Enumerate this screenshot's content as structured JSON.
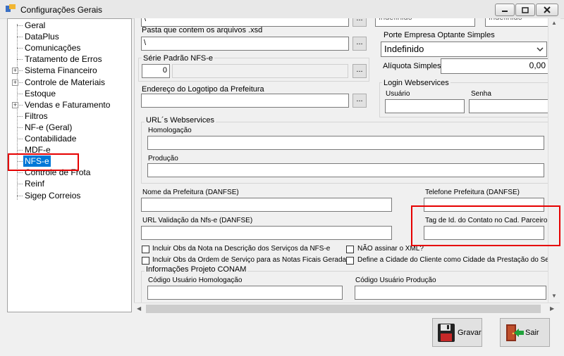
{
  "window": {
    "title": "Configurações Gerais"
  },
  "tree": {
    "items": [
      {
        "label": "Geral"
      },
      {
        "label": "DataPlus"
      },
      {
        "label": "Comunicações"
      },
      {
        "label": "Tratamento de Erros"
      },
      {
        "label": "Sistema Financeiro",
        "expander": "+"
      },
      {
        "label": "Controle de Materiais",
        "expander": "+"
      },
      {
        "label": "Estoque"
      },
      {
        "label": "Vendas e Faturamento",
        "expander": "+"
      },
      {
        "label": "Filtros"
      },
      {
        "label": "NF-e (Geral)"
      },
      {
        "label": "Contabilidade"
      },
      {
        "label": "MDF-e"
      },
      {
        "label": "NFS-e",
        "selected": true
      },
      {
        "label": "Controle de Frota"
      },
      {
        "label": "Reinf"
      },
      {
        "label": "Sigep Correios"
      }
    ]
  },
  "top_partial": {
    "left_value": "\\",
    "combo_a": "Indefinido",
    "combo_b": "Indefinido"
  },
  "xsd": {
    "label": "Pasta que contem os arquivos .xsd",
    "value": "\\"
  },
  "serie": {
    "label": "Série Padrão NFS-e",
    "value": "0"
  },
  "logotipo": {
    "label": "Endereço do Logotipo da Prefeitura",
    "value": ""
  },
  "porte": {
    "label": "Porte Empresa Optante Simples",
    "value": "Indefinido"
  },
  "aliquota": {
    "label": "Alíquota Simples:",
    "value": "0,00"
  },
  "login": {
    "title": "Login Webservices",
    "user_label": "Usuário",
    "pass_label": "Senha",
    "user_value": "",
    "pass_value": ""
  },
  "urls": {
    "title": "URL´s Webservices",
    "homolog_label": "Homologação",
    "prod_label": "Produção",
    "homolog_value": "",
    "prod_value": ""
  },
  "nome_prefeitura": {
    "label": "Nome da Prefeitura (DANFSE)",
    "value": ""
  },
  "telefone": {
    "label": "Telefone Prefeitura (DANFSE)",
    "value": ""
  },
  "url_validacao": {
    "label": "URL Validação da Nfs-e (DANFSE)",
    "value": ""
  },
  "tag_contato": {
    "label": "Tag de Id. do Contato no Cad. Parceiro",
    "value": ""
  },
  "checks": {
    "obs_nota": "Incluir Obs da Nota na Descrição dos Serviços da NFS-e",
    "obs_os": "Incluir Obs da Ordem de Serviço para as Notas Ficais Geradas",
    "nao_assinar": "NÃO assinar o XML?",
    "cidade_cliente": "Define a Cidade do Cliente como Cidade da Prestação do Serviço"
  },
  "conam": {
    "title": "Informações Projeto CONAM",
    "homolog_label": "Código Usuário Homologação",
    "prod_label": "Código Usuário Produção",
    "homolog_value": "",
    "prod_value": ""
  },
  "buttons": {
    "save": "Gravar",
    "exit": "Sair"
  },
  "colors": {
    "selection": "#0078d7",
    "highlight_box": "#e60000"
  },
  "icons": {
    "save": "floppy-disk-icon",
    "exit": "exit-door-icon"
  }
}
